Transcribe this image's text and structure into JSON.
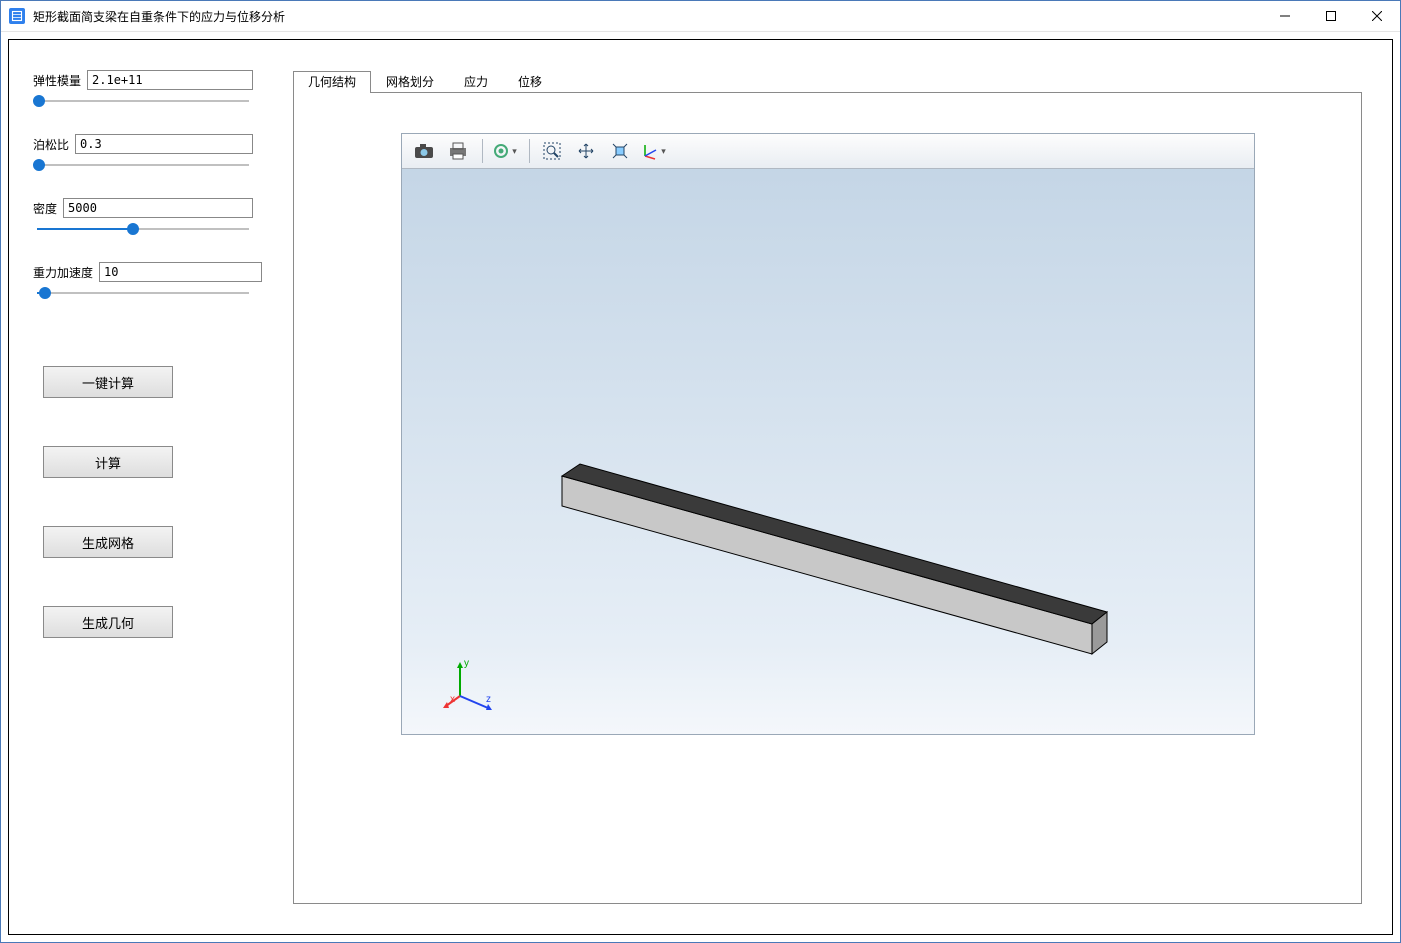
{
  "window": {
    "title": "矩形截面简支梁在自重条件下的应力与位移分析"
  },
  "sidebar": {
    "params": {
      "elastic_modulus": {
        "label": "弹性模量",
        "value": "2.1e+11",
        "slider_pct": 0
      },
      "poisson": {
        "label": "泊松比",
        "value": "0.3",
        "slider_pct": 0
      },
      "density": {
        "label": "密度",
        "value": "5000",
        "slider_pct": 45
      },
      "gravity": {
        "label": "重力加速度",
        "value": "10",
        "slider_pct": 5
      }
    },
    "buttons": {
      "oneclick": "一键计算",
      "compute": "计算",
      "mesh": "生成网格",
      "geom": "生成几何"
    }
  },
  "tabs": {
    "geometry": "几何结构",
    "mesh": "网格划分",
    "stress": "应力",
    "displacement": "位移",
    "active": "geometry"
  },
  "toolbar_icons": {
    "camera": "camera-icon",
    "print": "print-icon",
    "settings": "gear-icon",
    "zoom": "zoom-box-icon",
    "pan": "pan-icon",
    "fit": "fit-icon",
    "axes": "axes-icon"
  },
  "triad_labels": {
    "x": "x",
    "y": "y",
    "z": "z"
  }
}
